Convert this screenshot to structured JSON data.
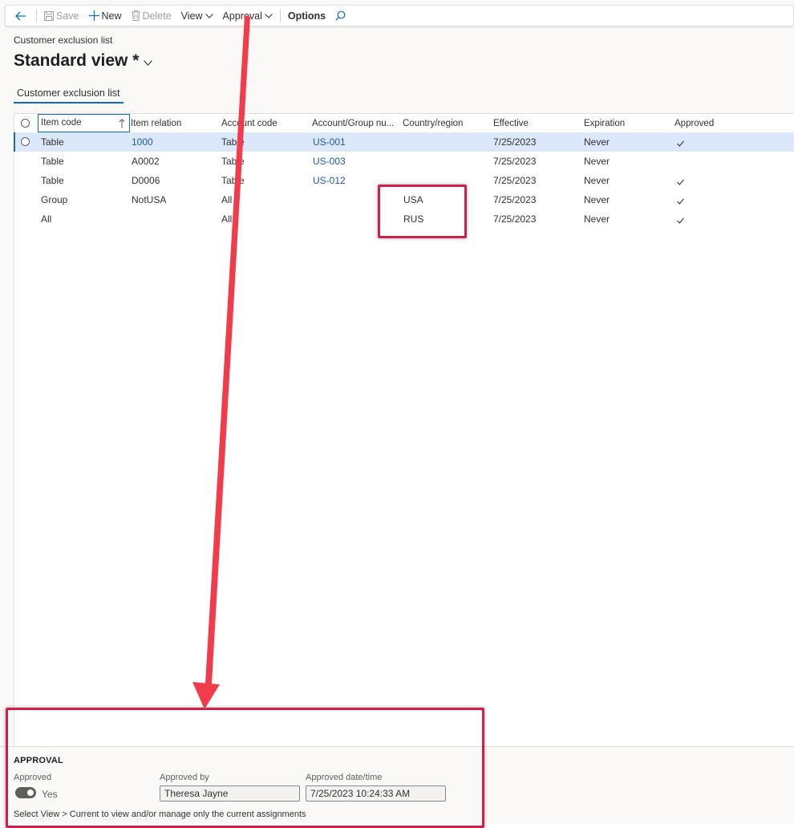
{
  "toolbar": {
    "save_label": "Save",
    "new_label": "New",
    "delete_label": "Delete",
    "view_label": "View",
    "approval_label": "Approval",
    "options_label": "Options"
  },
  "breadcrumb": "Customer exclusion list",
  "view_title": "Standard view *",
  "tab_label": "Customer exclusion list",
  "grid": {
    "columns": [
      "Item code",
      "Item relation",
      "Account code",
      "Account/Group nu...",
      "Country/region",
      "Effective",
      "Expiration",
      "Approved"
    ],
    "rows": [
      {
        "item_code": "Table",
        "item_relation": "1000",
        "account_code": "Table",
        "account_group": "US-001",
        "country": "",
        "effective": "7/25/2023",
        "expiration": "Never",
        "approved": true,
        "selected": true
      },
      {
        "item_code": "Table",
        "item_relation": "A0002",
        "account_code": "Table",
        "account_group": "US-003",
        "country": "",
        "effective": "7/25/2023",
        "expiration": "Never",
        "approved": false,
        "selected": false
      },
      {
        "item_code": "Table",
        "item_relation": "D0006",
        "account_code": "Table",
        "account_group": "US-012",
        "country": "",
        "effective": "7/25/2023",
        "expiration": "Never",
        "approved": true,
        "selected": false
      },
      {
        "item_code": "Group",
        "item_relation": "NotUSA",
        "account_code": "All",
        "account_group": "",
        "country": "USA",
        "effective": "7/25/2023",
        "expiration": "Never",
        "approved": true,
        "selected": false
      },
      {
        "item_code": "All",
        "item_relation": "",
        "account_code": "All",
        "account_group": "",
        "country": "RUS",
        "effective": "7/25/2023",
        "expiration": "Never",
        "approved": true,
        "selected": false
      }
    ]
  },
  "approval": {
    "heading": "APPROVAL",
    "approved_label": "Approved",
    "approved_value": "Yes",
    "approved_by_label": "Approved by",
    "approved_by_value": "Theresa Jayne",
    "approved_datetime_label": "Approved date/time",
    "approved_datetime_value": "7/25/2023 10:24:33 AM",
    "note": "Select View > Current to view and/or manage only the current assignments"
  },
  "colors": {
    "accent": "#0f6cbd",
    "annotation": "#d21f4a",
    "arrow": "#f03c4b",
    "selected_row": "#dbe7fb"
  }
}
